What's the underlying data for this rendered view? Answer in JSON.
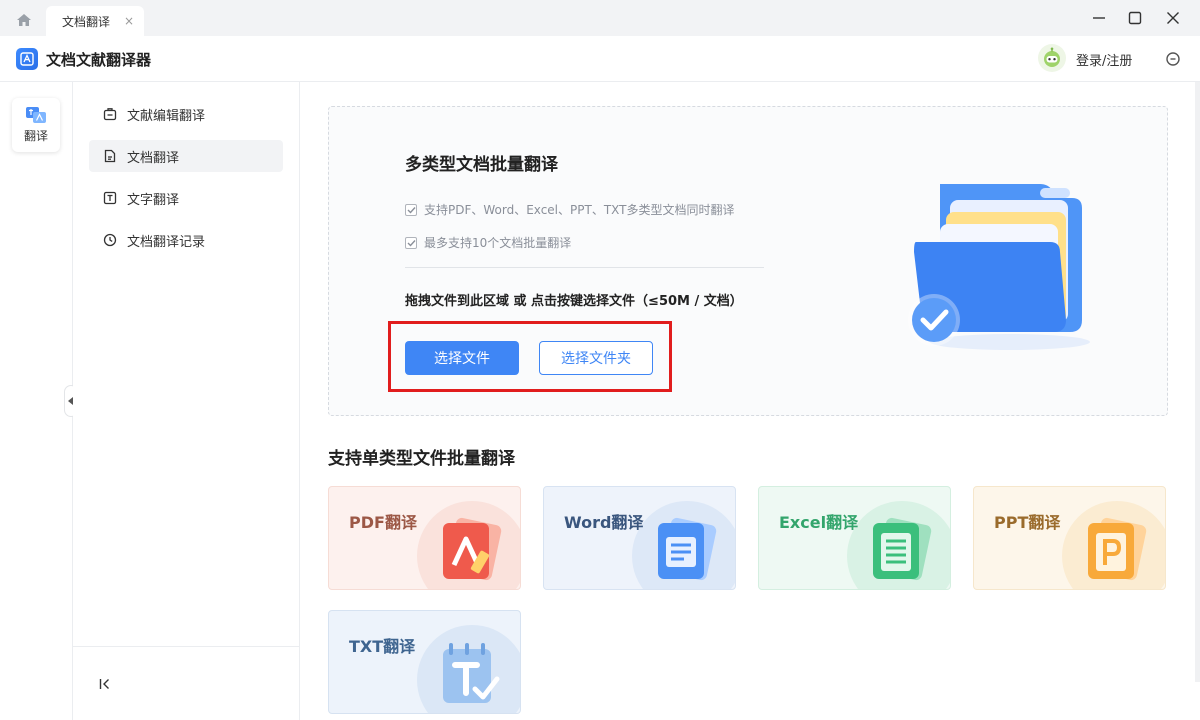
{
  "titlebar": {
    "tab_label": "文档翻译",
    "tab_close": "×"
  },
  "app": {
    "title": "文档文献翻译器",
    "login_label": "登录/注册"
  },
  "rail": {
    "item_label": "翻译"
  },
  "menu": {
    "items": [
      {
        "label": "文献编辑翻译",
        "icon": "briefcase-icon",
        "active": false
      },
      {
        "label": "文档翻译",
        "icon": "document-icon",
        "active": true
      },
      {
        "label": "文字翻译",
        "icon": "text-box-icon",
        "active": false
      },
      {
        "label": "文档翻译记录",
        "icon": "clock-icon",
        "active": false
      }
    ]
  },
  "upload": {
    "title": "多类型文档批量翻译",
    "features": [
      "支持PDF、Word、Excel、PPT、TXT多类型文档同时翻译",
      "最多支持10个文档批量翻译"
    ],
    "hint": "拖拽文件到此区域 或 点击按键选择文件（≤50M / 文档）",
    "select_file_button": "选择文件",
    "select_folder_button": "选择文件夹"
  },
  "types": {
    "section_title": "支持单类型文件批量翻译",
    "cards": [
      {
        "label": "PDF翻译",
        "icon": "pdf-file-icon"
      },
      {
        "label": "Word翻译",
        "icon": "word-file-icon"
      },
      {
        "label": "Excel翻译",
        "icon": "excel-file-icon"
      },
      {
        "label": "PPT翻译",
        "icon": "ppt-file-icon"
      },
      {
        "label": "TXT翻译",
        "icon": "txt-file-icon"
      }
    ]
  },
  "colors": {
    "accent": "#3f86f5",
    "highlight": "#e11d1d"
  }
}
